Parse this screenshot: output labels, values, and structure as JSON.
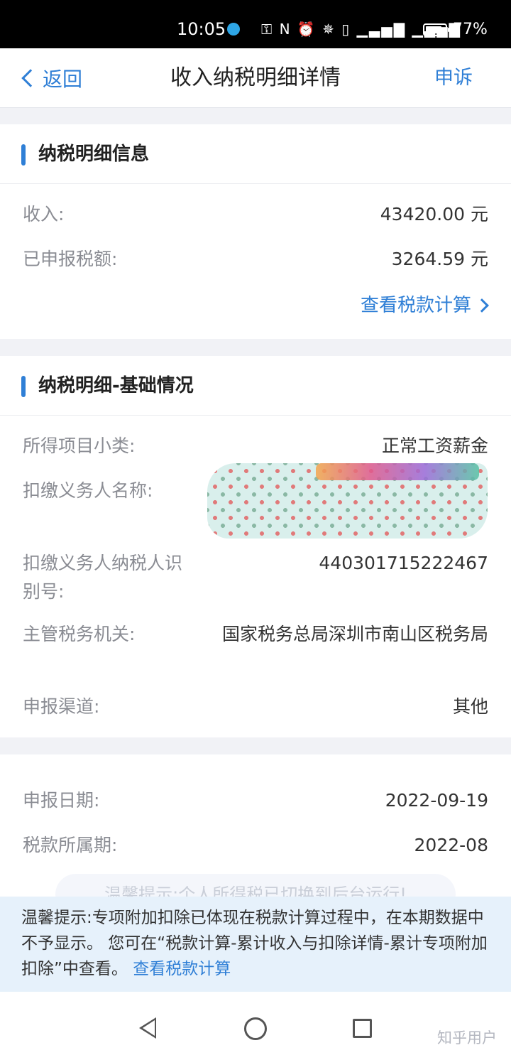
{
  "status_bar": {
    "time": "10:05",
    "icons": "⚿ N ⏰ ✵ ▯ ▁▃▅▇ ▁▃▅▇",
    "battery": "77%"
  },
  "header": {
    "back_label": "返回",
    "title": "收入纳税明细详情",
    "appeal_label": "申诉"
  },
  "section1": {
    "title": "纳税明细信息",
    "income_label": "收入:",
    "income_value": "43420.00 元",
    "tax_label": "已申报税额:",
    "tax_value": "3264.59 元",
    "view_calc_label": "查看税款计算"
  },
  "section2": {
    "title": "纳税明细-基础情况",
    "rows": [
      {
        "label": "所得项目小类:",
        "value": "正常工资薪金"
      },
      {
        "label": "扣缴义务人名称:",
        "value": ""
      },
      {
        "label": "扣缴义务人纳税人识别号:",
        "value": "440301715222467"
      },
      {
        "label": "主管税务机关:",
        "value": "国家税务总局深圳市南山区税务局"
      },
      {
        "label": "申报渠道:",
        "value": "其他"
      }
    ]
  },
  "section3": {
    "rows": [
      {
        "label": "申报日期:",
        "value": "2022-09-19"
      },
      {
        "label": "税款所属期:",
        "value": "2022-08"
      }
    ]
  },
  "toast": {
    "text": "温馨提示:个人所得税已切换到后台运行!"
  },
  "tip": {
    "text": "温馨提示:专项附加扣除已体现在税款计算过程中，在本期数据中不予显示。 您可在“税款计算-累计收入与扣除详情-累计专项附加扣除”中查看。 ",
    "link": "查看税款计算"
  },
  "watermark": "知乎用户",
  "colors": {
    "accent": "#2f7fd6",
    "tip_bg": "#e6f1fb",
    "page_bg": "#f1f2f6"
  }
}
